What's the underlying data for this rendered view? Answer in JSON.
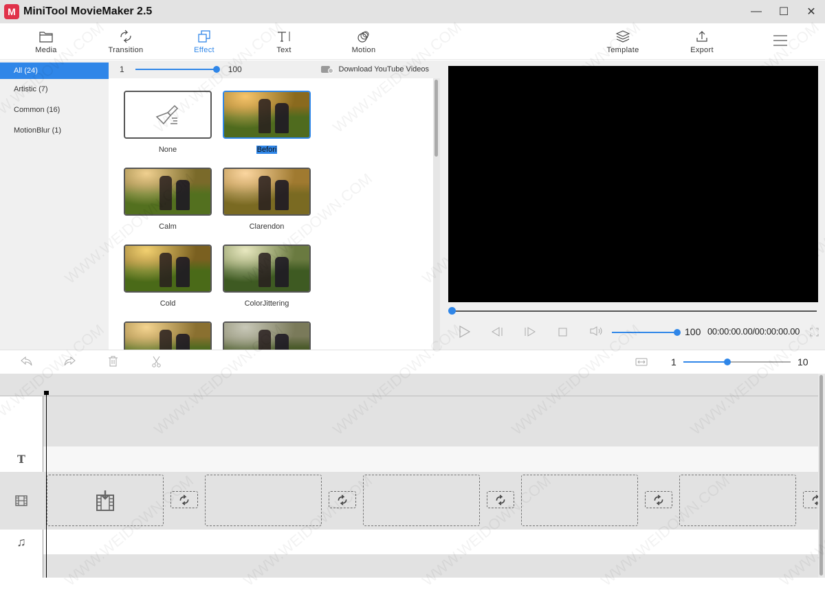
{
  "app": {
    "title": "MiniTool MovieMaker 2.5",
    "logo": "M"
  },
  "window_controls": {
    "minimize": "—",
    "maximize": "☐",
    "close": "✕"
  },
  "toolbar": {
    "items": [
      {
        "label": "Media",
        "icon": "folder-icon"
      },
      {
        "label": "Transition",
        "icon": "transition-icon"
      },
      {
        "label": "Effect",
        "icon": "effect-icon",
        "active": true
      },
      {
        "label": "Text",
        "icon": "text-icon"
      },
      {
        "label": "Motion",
        "icon": "motion-icon"
      }
    ],
    "right": [
      {
        "label": "Template",
        "icon": "layers-icon"
      },
      {
        "label": "Export",
        "icon": "upload-icon"
      }
    ],
    "menu_icon": "☰"
  },
  "categories": [
    {
      "label": "All",
      "count": "(24)",
      "active": true
    },
    {
      "label": "Artistic",
      "count": "(7)"
    },
    {
      "label": "Common",
      "count": "(16)"
    },
    {
      "label": "MotionBlur",
      "count": "(1)"
    }
  ],
  "grid_header": {
    "size_min": "1",
    "size_max": "100",
    "size_value_fraction": 1.0,
    "download_label": "Download YouTube Videos"
  },
  "effects": [
    {
      "label": "None",
      "type": "none"
    },
    {
      "label": "Befori",
      "selected": true
    },
    {
      "label": "Calm"
    },
    {
      "label": "Clarendon"
    },
    {
      "label": "Cold"
    },
    {
      "label": "ColorJittering"
    },
    {
      "label": ""
    },
    {
      "label": ""
    }
  ],
  "player": {
    "progress_fraction": 0,
    "volume": "100",
    "volume_fraction": 1.0,
    "time": "00:00:00.00/00:00:00.00"
  },
  "timeline_toolbar": {
    "zoom_min": "1",
    "zoom_max": "10",
    "zoom_fraction": 0.41
  },
  "tracks": {
    "text_icon": "T",
    "video_icon": "film-icon",
    "audio_icon": "♫"
  },
  "watermark": "WWW.WEIDOWN.COM"
}
